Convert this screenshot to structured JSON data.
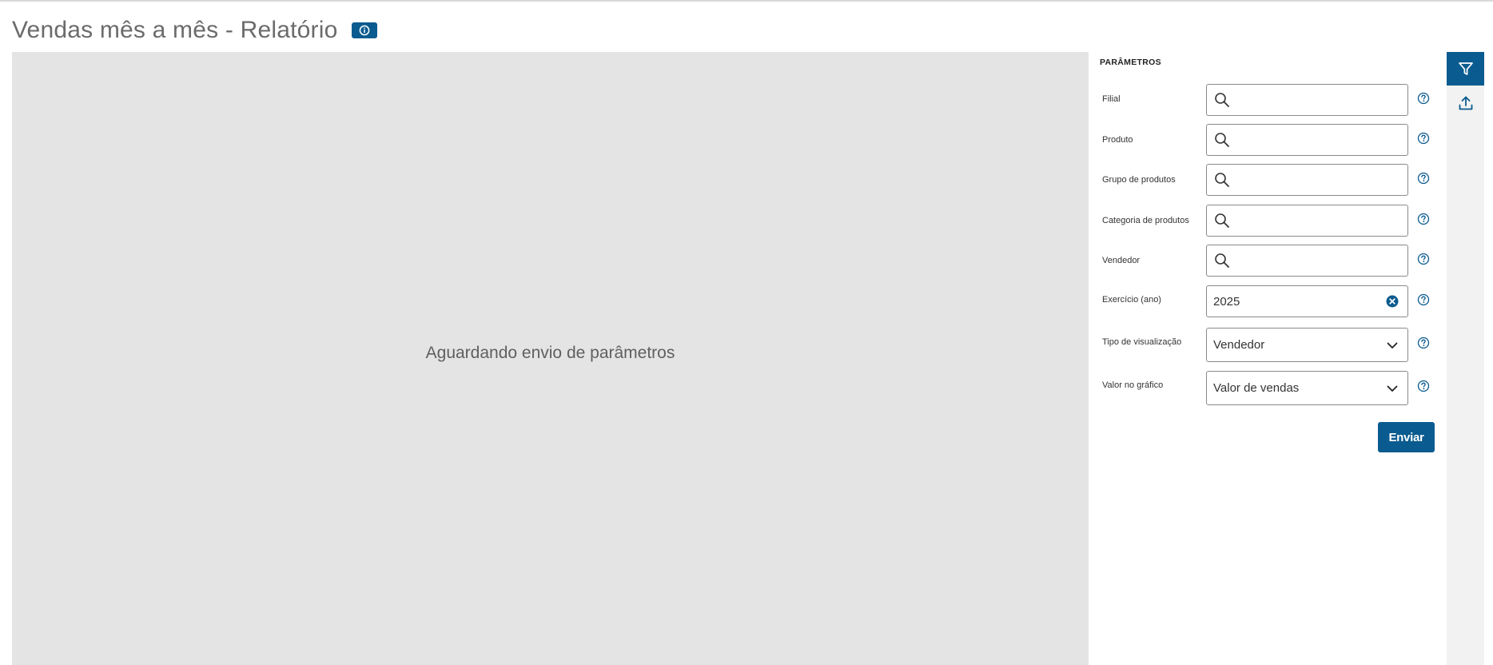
{
  "page": {
    "title": "Vendas mês a mês - Relatório",
    "info_icon": "info-icon"
  },
  "main": {
    "placeholder": "Aguardando envio de parâmetros"
  },
  "parameters": {
    "heading": "PARÂMETROS",
    "fields": [
      {
        "label": "Filial",
        "type": "lookup",
        "value": "",
        "icon": "search-icon"
      },
      {
        "label": "Produto",
        "type": "lookup",
        "value": "",
        "icon": "search-icon"
      },
      {
        "label": "Grupo de produtos",
        "type": "lookup",
        "value": "",
        "icon": "search-icon"
      },
      {
        "label": "Categoria de produtos",
        "type": "lookup",
        "value": "",
        "icon": "search-icon"
      },
      {
        "label": "Vendedor",
        "type": "lookup",
        "value": "",
        "icon": "search-icon"
      },
      {
        "label": "Exercício (ano)",
        "type": "text",
        "value": "2025",
        "icon": "clear-icon"
      },
      {
        "label": "Tipo de visualização",
        "type": "select",
        "value": "Vendedor",
        "icon": "chevron-down-icon"
      },
      {
        "label": "Valor no gráfico",
        "type": "select",
        "value": "Valor de vendas",
        "icon": "chevron-down-icon"
      }
    ],
    "submit_label": "Enviar"
  },
  "side_rail": {
    "items": [
      {
        "icon": "filter-icon",
        "active": true
      },
      {
        "icon": "upload-icon",
        "active": false
      }
    ]
  },
  "colors": {
    "primary": "#0a5b8f",
    "panel_bg": "#e4e4e4",
    "rail_bg": "#f2f2f2"
  }
}
